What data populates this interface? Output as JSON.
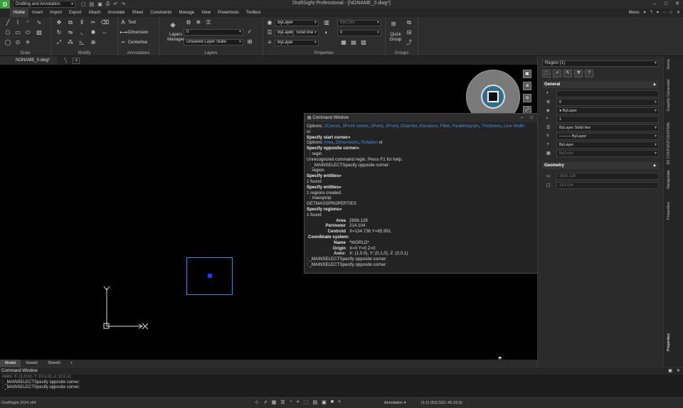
{
  "app": {
    "logo": "D",
    "workspace": "Drafting and Annotation",
    "title": "DraftSight Professional - [NONAME_0.dwg*]",
    "win_buttons": [
      "–",
      "□",
      "✕"
    ]
  },
  "menu": {
    "tabs": [
      "Home",
      "Insert",
      "Import",
      "Export",
      "Attach",
      "Annotate",
      "Sheet",
      "Constraints",
      "Manage",
      "View",
      "Powertools",
      "Toolbox"
    ],
    "right": [
      "Menu",
      "▾",
      "?",
      "▾",
      "–",
      "□",
      "✕"
    ]
  },
  "ribbon": {
    "groups": {
      "draw": "Draw",
      "modify": "Modify",
      "annotations": "Annotations",
      "layers": "Layers",
      "properties": "Properties",
      "groups": "Groups"
    },
    "annotations": {
      "text": "Text",
      "dimension": "Dimension",
      "centerline": "Centerline"
    },
    "layers_manager": "Layers Manager",
    "layer_value": "0",
    "layer_state": "Unsaved Layer State",
    "color_value": "ByLayer",
    "linestyle_value": "Solid line",
    "layer_prop1": "ByLayer",
    "lineweight_value": "ByLayer",
    "transparency_value": "ByColor",
    "opacity_value": "0",
    "quick_group": "Quick Group"
  },
  "doc": {
    "tab_name": "NONAME_0.dwg*",
    "add": "+"
  },
  "command_window": {
    "title": "Command Window",
    "options_line": {
      "prefix": "Options: ",
      "options": [
        "2Corner",
        "3Point center",
        "2Point",
        "3Point",
        "Chamfer",
        "Elevation",
        "Fillet",
        "Parallelogram",
        "Thickness",
        "Line Width"
      ],
      "suffix": ""
    },
    "lines_a": [
      "or",
      "Specify start corner»"
    ],
    "options2": {
      "prefix": "Options: ",
      "options": [
        "Area",
        "Dimensions",
        "Rotation"
      ],
      "suffix": " or"
    },
    "lines_b": [
      {
        "text": "Specify opposite corner»",
        "style": "bold"
      },
      {
        "text": ": regin",
        "style": "ind"
      },
      {
        "text": "Unrecognized command regin. Press F1 for help.",
        "style": ""
      },
      {
        "text": ": _MAINSELECTSpecify opposite corner:",
        "style": "ind"
      },
      {
        "text": ": region",
        "style": "ind"
      },
      {
        "text": "Specify entities»",
        "style": "bold"
      },
      {
        "text": "1 found",
        "style": ""
      },
      {
        "text": "Specify entities»",
        "style": "bold"
      },
      {
        "text": "1 regions created.",
        "style": ""
      },
      {
        "text": ": massprop",
        "style": "ind"
      },
      {
        "text": "GETMASSPROPERTIES",
        "style": ""
      },
      {
        "text": "Specify regions»",
        "style": "bold"
      },
      {
        "text": "1 found",
        "style": ""
      }
    ],
    "props": [
      {
        "k": "Area",
        "v": "2836.128"
      },
      {
        "k": "Perimeter",
        "v": "214.104"
      },
      {
        "k": "Centroid",
        "v": "X=134.736 Y=65.991"
      }
    ],
    "coord_header": "Coordinate system:",
    "coord": [
      {
        "k": "Name",
        "v": "*WORLD*"
      },
      {
        "k": "Origin",
        "v": "X=0 Y=0 Z=0"
      },
      {
        "k": "Axes:",
        "v": "X: (1,0,0), Y: (0,1,0), Z: (0,0,1)"
      }
    ],
    "tail": [
      ": _MAINSELECTSpecify opposite corner:",
      ": _MAINSELECTSpecify opposite corner:"
    ]
  },
  "layout_tabs": [
    "Model",
    "Sheet1",
    "Sheet2",
    "+"
  ],
  "cmd_panel": {
    "title": "Command Window",
    "lines": [
      "Axes:  X: (1,0,0), Y: (0,1,0), Z: (0,0,1)",
      ": _MAINSELECTSpecify opposite corner:",
      ": _MAINSELECTSpecify opposite corner:"
    ],
    "buttons": [
      "▣",
      "✕"
    ]
  },
  "status": {
    "app_version": "DraftSight 2024 x64",
    "annotation": "Annotation",
    "scale": "(1:1)  (511.522,-42.23,0)"
  },
  "properties": {
    "selector": "Region (1)",
    "section_general": "General",
    "general_rows": [
      {
        "icon": "◐",
        "value": "",
        "dim": false,
        "drop": false
      },
      {
        "icon": "≣",
        "value": "0",
        "dim": false,
        "drop": true
      },
      {
        "icon": "◈",
        "value": "● ByLayer",
        "dim": false,
        "drop": true
      },
      {
        "icon": "▪",
        "value": "1",
        "dim": false,
        "drop": false
      },
      {
        "icon": "☰",
        "value": "ByLayer      Solid line",
        "dim": false,
        "drop": true
      },
      {
        "icon": "≡",
        "value": "——— ByLayer",
        "dim": false,
        "drop": true
      },
      {
        "icon": "◑",
        "value": "ByLayer",
        "dim": false,
        "drop": true
      },
      {
        "icon": "▦",
        "value": "ByColor",
        "dim": true,
        "drop": true
      }
    ],
    "section_geometry": "Geometry",
    "geometry_rows": [
      {
        "icon": "▭",
        "value": "2836.128",
        "dim": true
      },
      {
        "icon": "▢",
        "value": "214.104",
        "dim": true
      }
    ]
  },
  "side_tabs": [
    "Home",
    "Graphic Generator",
    "3D CONTENTCENTRAL",
    "Manipulate",
    "Properties"
  ]
}
